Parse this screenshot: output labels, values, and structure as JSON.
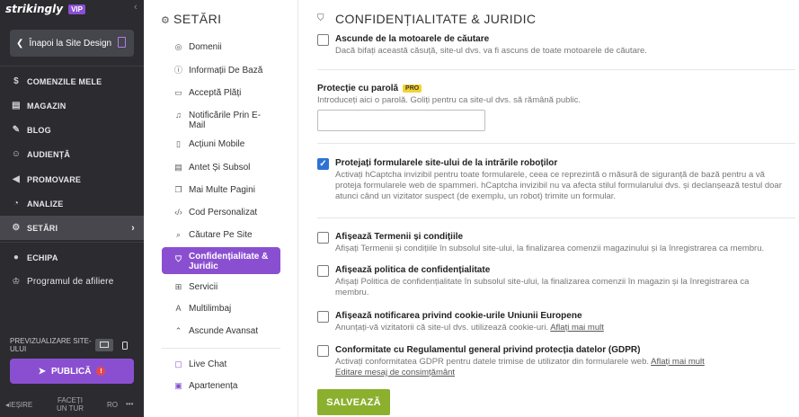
{
  "app": {
    "logo_text": "strikingly",
    "vip_badge": "VIP"
  },
  "leftbar": {
    "back_label": "Înapoi la Site Design",
    "items": [
      {
        "label": "COMENZILE MELE",
        "icon": "dollar-icon"
      },
      {
        "label": "MAGAZIN",
        "icon": "store-icon"
      },
      {
        "label": "BLOG",
        "icon": "pen-icon"
      },
      {
        "label": "AUDIENȚĂ",
        "icon": "people-icon"
      },
      {
        "label": "PROMOVARE",
        "icon": "megaphone-icon"
      },
      {
        "label": "ANALIZE",
        "icon": "gauge-icon"
      },
      {
        "label": "SETĂRI",
        "icon": "gear-icon"
      },
      {
        "label": "ECHIPA",
        "icon": "team-icon"
      },
      {
        "label": "Programul de afiliere",
        "icon": "trophy-icon"
      }
    ],
    "preview_label": "PREVIZUALIZARE SITE-ULUI",
    "publish_label": "PUBLICĂ",
    "publish_warning": "!",
    "bottom": {
      "exit": "IEȘIRE",
      "tour": "FACEȚI UN TUR",
      "lang": "RO",
      "more": "•••"
    }
  },
  "subnav": {
    "title": "SETĂRI",
    "items": [
      {
        "label": "Domenii",
        "icon": "globe-icon"
      },
      {
        "label": "Informații De Bază",
        "icon": "info-icon"
      },
      {
        "label": "Acceptă Plăți",
        "icon": "card-icon"
      },
      {
        "label": "Notificările Prin E-Mail",
        "icon": "bell-icon"
      },
      {
        "label": "Acțiuni Mobile",
        "icon": "phone-icon"
      },
      {
        "label": "Antet Și Subsol",
        "icon": "layout-icon"
      },
      {
        "label": "Mai Multe Pagini",
        "icon": "pages-icon"
      },
      {
        "label": "Cod Personalizat",
        "icon": "code-icon"
      },
      {
        "label": "Căutare Pe Site",
        "icon": "search-icon"
      },
      {
        "label": "Confidențialitate & Juridic",
        "icon": "shield-icon"
      },
      {
        "label": "Servicii",
        "icon": "grid-icon"
      },
      {
        "label": "Multilimbaj",
        "icon": "translate-icon"
      },
      {
        "label": "Ascunde Avansat",
        "icon": "chevron-up-icon"
      },
      {
        "label": "Live Chat",
        "icon": "chat-icon"
      },
      {
        "label": "Apartenența",
        "icon": "member-icon"
      }
    ]
  },
  "main": {
    "title": "CONFIDENȚIALITATE & JURIDIC",
    "hide_search": {
      "title": "Ascunde de la motoarele de căutare",
      "desc": "Dacă bifați această căsuță, site-ul dvs. va fi ascuns de toate motoarele de căutare.",
      "checked": false
    },
    "password": {
      "title": "Protecție cu parolă",
      "badge": "PRO",
      "desc": "Introduceți aici o parolă. Goliți pentru ca site-ul dvs. să rămână public.",
      "value": ""
    },
    "robots": {
      "title": "Protejați formularele site-ului de la intrările roboților",
      "desc": "Activați hCaptcha invizibil pentru toate formularele, ceea ce reprezintă o măsură de siguranță de bază pentru a vă proteja formularele web de spammeri. hCaptcha invizibil nu va afecta stilul formularului dvs. și declanșează testul doar atunci când un vizitator suspect (de exemplu, un robot) trimite un formular.",
      "checked": true
    },
    "terms": {
      "title": "Afișează Termenii și condițiile",
      "desc": "Afișați Termenii și condițiile în subsolul site-ului, la finalizarea comenzii magazinului și la înregistrarea ca membru.",
      "checked": false
    },
    "privacy": {
      "title": "Afișează politica de confidențialitate",
      "desc": "Afișați Politica de confidențialitate în subsolul site-ului, la finalizarea comenzii în magazin și la înregistrarea ca membru.",
      "checked": false
    },
    "cookies": {
      "title": "Afișează notificarea privind cookie-urile Uniunii Europene",
      "desc": "Anunțați-vă vizitatorii că site-ul dvs. utilizează cookie-uri.",
      "link": "Aflați mai mult",
      "checked": false
    },
    "gdpr": {
      "title": "Conformitate cu Regulamentul general privind protecția datelor (GDPR)",
      "desc": "Activați conformitatea GDPR pentru datele trimise de utilizator din formularele web.",
      "link": "Aflați mai mult",
      "link2": "Editare mesaj de consimțământ",
      "checked": false
    },
    "save_label": "SALVEAZĂ"
  }
}
